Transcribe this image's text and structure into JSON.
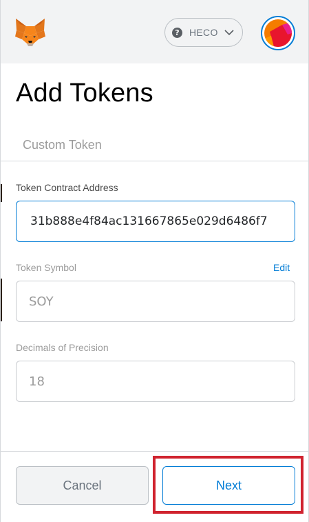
{
  "header": {
    "network": {
      "name": "HECO",
      "icon": "question-icon"
    },
    "logo": "metamask-fox-icon",
    "avatar": "account-avatar"
  },
  "page": {
    "title": "Add Tokens",
    "tabs": [
      {
        "label": "Custom Token",
        "active": true
      }
    ]
  },
  "form": {
    "contract_address": {
      "label": "Token Contract Address",
      "value": "31b888e4f84ac131667865e029d6486f7"
    },
    "symbol": {
      "label": "Token Symbol",
      "edit_label": "Edit",
      "value": "SOY"
    },
    "decimals": {
      "label": "Decimals of Precision",
      "value": "18"
    }
  },
  "footer": {
    "cancel_label": "Cancel",
    "next_label": "Next"
  },
  "colors": {
    "accent": "#037dd6",
    "highlight": "#d0232f",
    "header_bg": "#f2f3f4"
  }
}
